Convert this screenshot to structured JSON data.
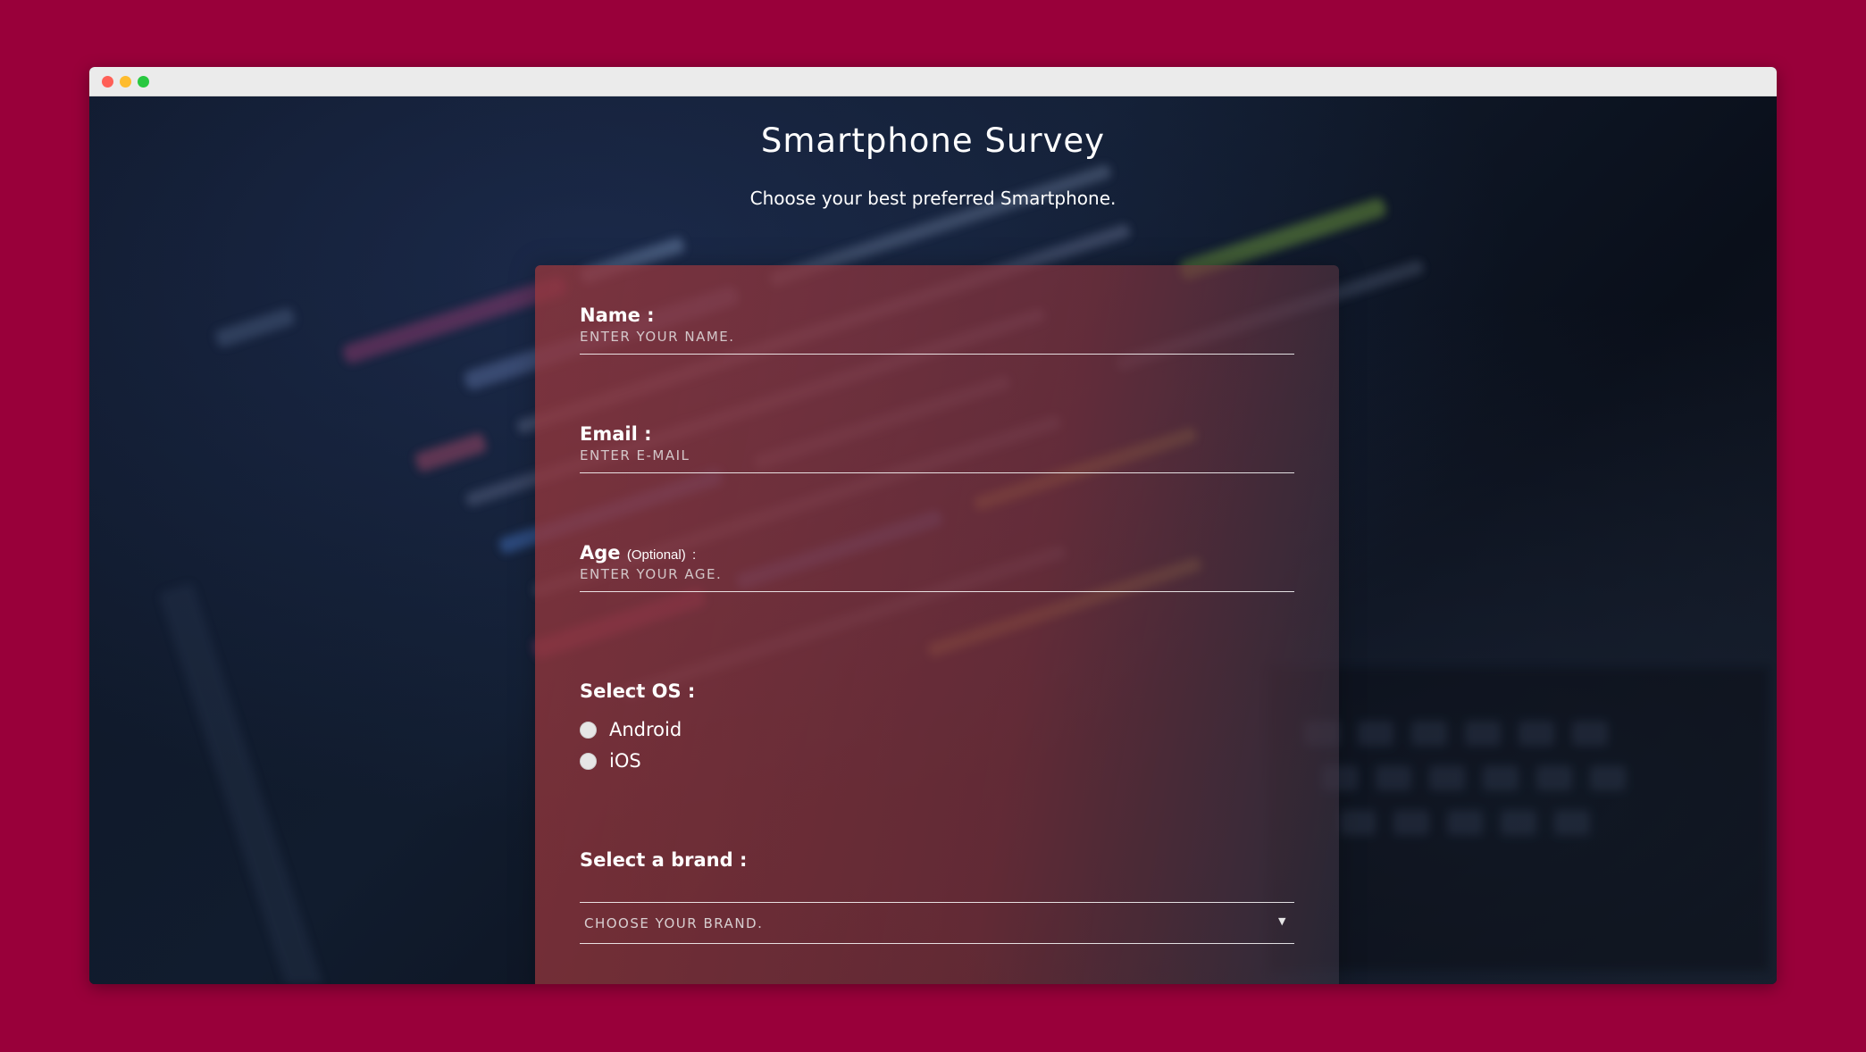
{
  "page": {
    "title": "Smartphone Survey",
    "subtitle": "Choose your best preferred Smartphone."
  },
  "form": {
    "name": {
      "label": "Name :",
      "placeholder": "ENTER YOUR NAME."
    },
    "email": {
      "label": "Email :",
      "placeholder": "ENTER E-MAIL"
    },
    "age": {
      "label": "Age",
      "optional_note": "(Optional)",
      "suffix": ":",
      "placeholder": "ENTER YOUR AGE."
    },
    "os": {
      "label": "Select OS :",
      "options": [
        "Android",
        "iOS"
      ]
    },
    "brand": {
      "label": "Select a brand :",
      "selected": "CHOOSE YOUR BRAND.",
      "arrow": "▼"
    }
  },
  "colors": {
    "page_background": "#99003a",
    "card_accent": "#96373c",
    "text": "#ffffff"
  }
}
